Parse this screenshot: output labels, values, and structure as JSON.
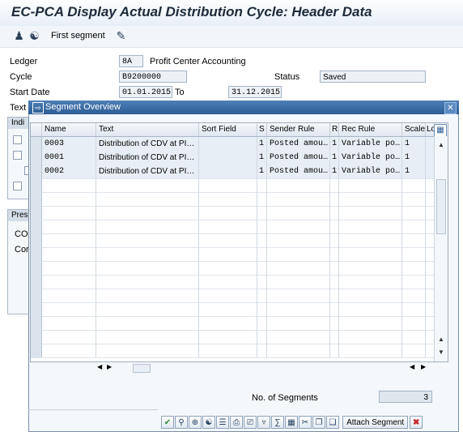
{
  "title": "EC-PCA Display Actual Distribution Cycle: Header Data",
  "toolbar": {
    "first_segment_label": "First segment"
  },
  "header": {
    "ledger_label": "Ledger",
    "ledger_value": "8A",
    "ledger_desc": "Profit Center Accounting",
    "cycle_label": "Cycle",
    "cycle_value": "B9200000",
    "status_label": "Status",
    "status_value": "Saved",
    "start_date_label": "Start Date",
    "start_date_value": "01.01.2015",
    "to_label": "To",
    "end_date_value": "31.12.2015",
    "text_label": "Text"
  },
  "background": {
    "ind_frame_title": "Indi",
    "pres_frame_title": "Pres",
    "pres_line1": "CO",
    "pres_line2": "Cor"
  },
  "dialog": {
    "title": "Segment Overview",
    "columns": [
      "Name",
      "Text",
      "Sort Field",
      "S",
      "Sender Rule",
      "R",
      "Rec Rule",
      "Scale",
      "Lo"
    ],
    "rows": [
      [
        "0003",
        "Distribution of CDV at PI…",
        "",
        "1",
        "Posted amou…",
        "1",
        "Variable po…",
        "1"
      ],
      [
        "0001",
        "Distribution of CDV at PI…",
        "",
        "1",
        "Posted amou…",
        "1",
        "Variable po…",
        "1"
      ],
      [
        "0002",
        "Distribution of CDV at PI…",
        "",
        "1",
        "Posted amou…",
        "1",
        "Variable po…",
        "1"
      ]
    ],
    "no_segments_label": "No. of Segments",
    "no_segments_value": "3",
    "attach_segment_label": "Attach Segment"
  }
}
